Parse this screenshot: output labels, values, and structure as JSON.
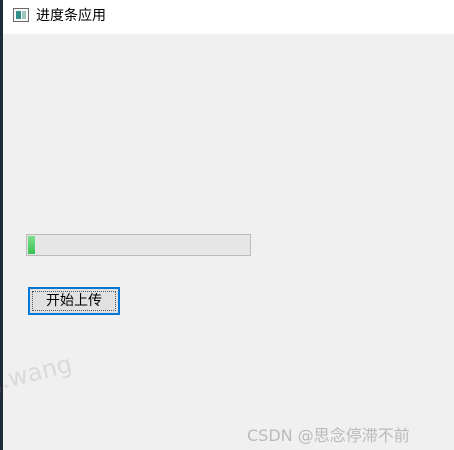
{
  "window": {
    "title": "进度条应用",
    "icon": "progress-app-icon"
  },
  "progress": {
    "value_percent": 3,
    "fill_color": "#4cd964"
  },
  "upload_button": {
    "label": "开始上传",
    "focus_color": "#0078d7"
  },
  "watermarks": {
    "left": "g.wang",
    "right": "CSDN @思念停滞不前"
  }
}
